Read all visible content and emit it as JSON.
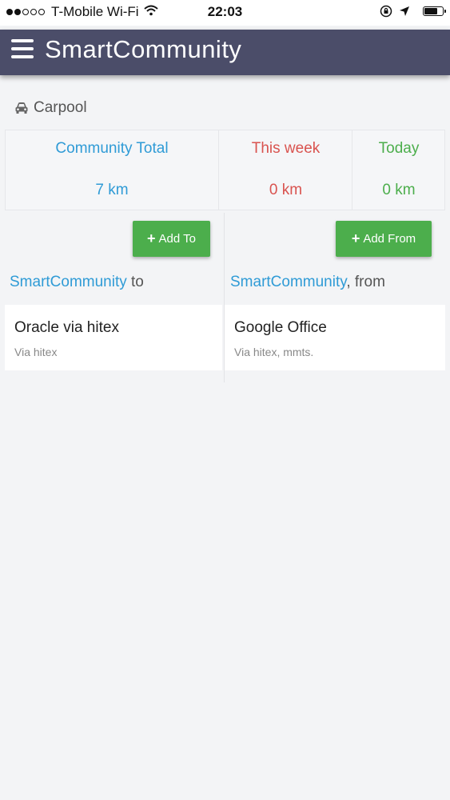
{
  "status_bar": {
    "carrier": "T-Mobile Wi-Fi",
    "time": "22:03"
  },
  "header": {
    "title": "SmartCommunity"
  },
  "section": {
    "label": "Carpool"
  },
  "stats": [
    {
      "title": "Community Total",
      "value": "7 km",
      "color": "#2f9bd6"
    },
    {
      "title": "This week",
      "value": "0 km",
      "color": "#d9534f"
    },
    {
      "title": "Today",
      "value": "0 km",
      "color": "#4cae4c"
    }
  ],
  "to_column": {
    "button_label": "Add To",
    "heading_brand": "SmartCommunity",
    "heading_rest": " to",
    "items": [
      {
        "title": "Oracle via hitex",
        "subtitle": "Via hitex"
      }
    ]
  },
  "from_column": {
    "button_label": "Add From",
    "heading_brand": "SmartCommunity",
    "heading_rest": ", from",
    "items": [
      {
        "title": "Google Office",
        "subtitle": "Via hitex, mmts."
      }
    ]
  },
  "colors": {
    "header_bg": "#4b4d69",
    "brand_blue": "#2f9bd6",
    "button_green": "#4cae4c",
    "week_red": "#d9534f"
  }
}
